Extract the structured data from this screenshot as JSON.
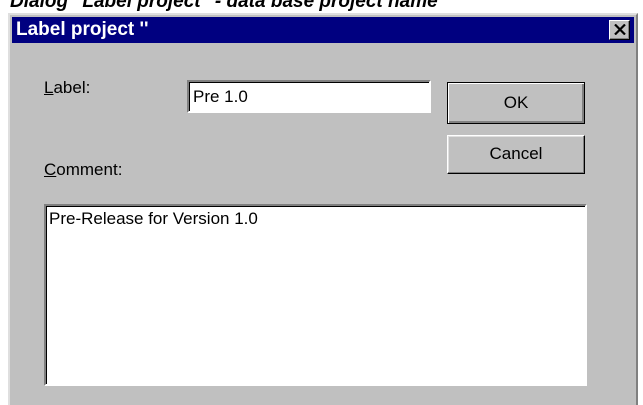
{
  "caption": "Dialog \"Label project\" - data base project name",
  "dialog": {
    "title": "Label project ''",
    "close_icon": "close-x-icon",
    "label_text": "Label:",
    "label_mnemonic": "L",
    "label_rest": "abel:",
    "label_value": "Pre 1.0",
    "comment_mnemonic": "C",
    "comment_rest": "omment:",
    "comment_value": "Pre-Release for Version 1.0",
    "ok_label": "OK",
    "cancel_label": "Cancel"
  },
  "colors": {
    "titlebar": "#000080",
    "face": "#c0c0c0",
    "field": "#ffffff"
  }
}
